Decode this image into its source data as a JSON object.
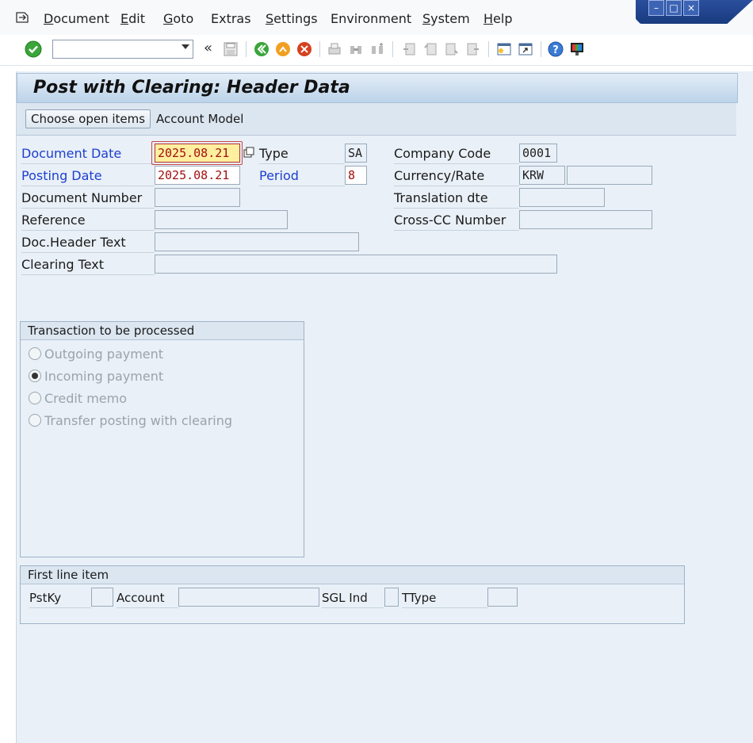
{
  "menu": {
    "items": [
      {
        "label": "Document",
        "key": "D",
        "rest": "ocument"
      },
      {
        "label": "Edit",
        "key": "E",
        "rest": "dit"
      },
      {
        "label": "Goto",
        "key": "G",
        "rest": "oto"
      },
      {
        "label": "Extras",
        "key": "",
        "rest": "Extras"
      },
      {
        "label": "Settings",
        "key": "S",
        "rest": "ettings"
      },
      {
        "label": "Environment",
        "key": "",
        "rest": "Environment"
      },
      {
        "label": "System",
        "key": "S",
        "rest": "ystem"
      },
      {
        "label": "Help",
        "key": "H",
        "rest": "elp"
      }
    ]
  },
  "toolbar": {
    "command_value": "",
    "back_chevron": "«"
  },
  "page": {
    "title": "Post with Clearing: Header Data"
  },
  "appbar": {
    "choose_open_items": "Choose open items",
    "account_model": "Account Model"
  },
  "header": {
    "document_date_label": "Document Date",
    "document_date": "2025.08.21",
    "type_label": "Type",
    "type": "SA",
    "company_code_label": "Company Code",
    "company_code": "0001",
    "posting_date_label": "Posting Date",
    "posting_date": "2025.08.21",
    "period_label": "Period",
    "period": "8",
    "currency_rate_label": "Currency/Rate",
    "currency": "KRW",
    "rate": "",
    "document_number_label": "Document Number",
    "document_number": "",
    "translation_date_label": "Translation dte",
    "translation_date": "",
    "reference_label": "Reference",
    "reference": "",
    "cross_cc_label": "Cross-CC Number",
    "cross_cc": "",
    "doc_header_text_label": "Doc.Header Text",
    "doc_header_text": "",
    "clearing_text_label": "Clearing Text",
    "clearing_text": ""
  },
  "transaction": {
    "title": "Transaction to be processed",
    "options": [
      {
        "label": "Outgoing payment",
        "selected": false
      },
      {
        "label": "Incoming payment",
        "selected": true
      },
      {
        "label": "Credit memo",
        "selected": false
      },
      {
        "label": "Transfer posting with clearing",
        "selected": false
      }
    ]
  },
  "first_line_item": {
    "title": "First line item",
    "pstky_label": "PstKy",
    "pstky": "",
    "account_label": "Account",
    "account": "",
    "sgl_ind_label": "SGL Ind",
    "sgl_ind": "",
    "ttype_label": "TType",
    "ttype": ""
  },
  "colors": {
    "accent_blue": "#1d3fd0",
    "panel_bg": "#e9f0f7",
    "required_highlight": "#ffef9e"
  }
}
